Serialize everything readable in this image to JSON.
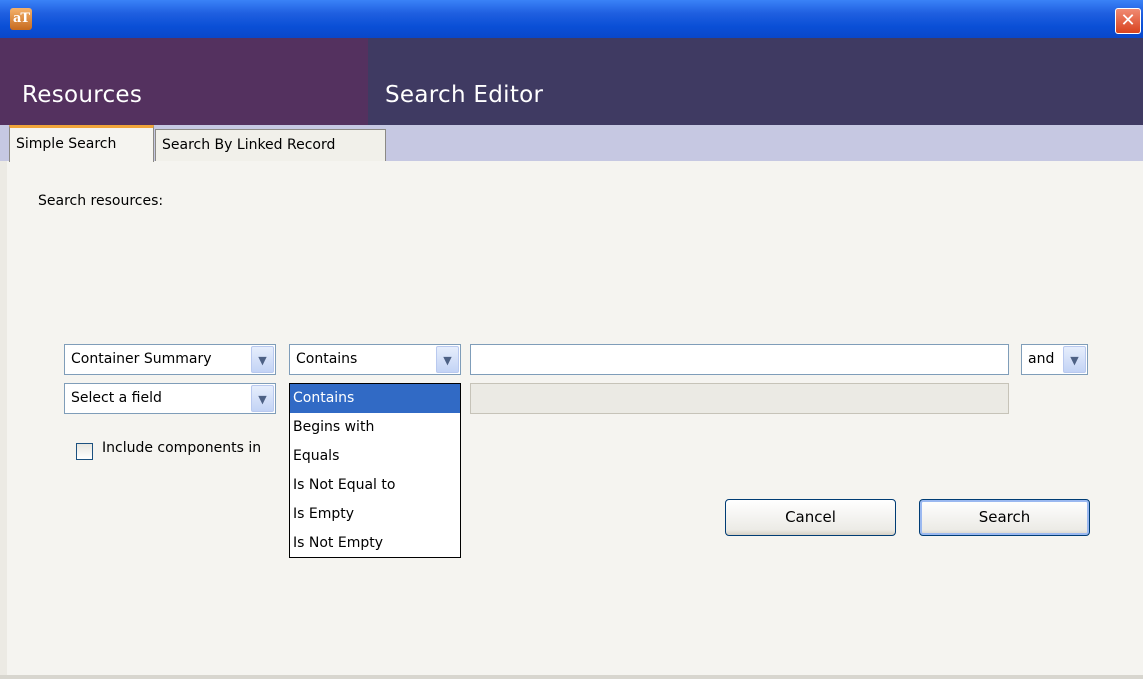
{
  "window": {
    "app_icon_text": "aT",
    "close_glyph": "✕"
  },
  "header": {
    "left_title": "Resources",
    "right_title": "Search Editor"
  },
  "tabs": [
    {
      "label": "Simple Search",
      "active": true
    },
    {
      "label": "Search By Linked Record",
      "active": false
    }
  ],
  "form": {
    "prompt": "Search resources:",
    "rows": [
      {
        "field": "Container Summary",
        "operator": "Contains",
        "value": "",
        "conjunction": "and"
      },
      {
        "field": "Select a field",
        "value": ""
      }
    ],
    "include_components_label": "Include components in",
    "include_components_checked": false
  },
  "operator_dropdown": {
    "options": [
      "Contains",
      "Begins with",
      "Equals",
      "Is Not Equal to",
      "Is Empty",
      "Is Not Empty"
    ],
    "selected_index": 0
  },
  "buttons": {
    "cancel": "Cancel",
    "search": "Search"
  },
  "icons": {
    "combo_arrow": "chevron-down-icon",
    "close": "close-icon",
    "app": "app-icon"
  },
  "colors": {
    "header_left": "#54315f",
    "header_right": "#3f3a62",
    "tab_accent": "#f0a43a",
    "selection": "#316ac5"
  }
}
